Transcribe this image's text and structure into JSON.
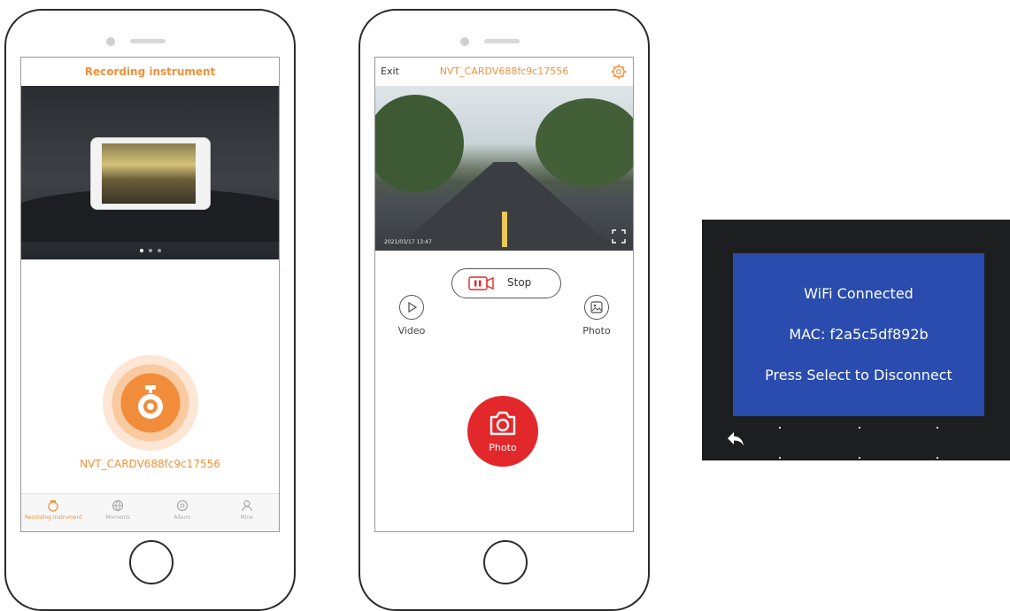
{
  "phone1": {
    "title": "Recording instrument",
    "device_name": "NVT_CARDV688fc9c17556",
    "nav": [
      {
        "label": "Recording instrument",
        "icon": "dashcam-icon",
        "active": true
      },
      {
        "label": "Moments",
        "icon": "globe-icon",
        "active": false
      },
      {
        "label": "Album",
        "icon": "album-icon",
        "active": false
      },
      {
        "label": "Mine",
        "icon": "person-icon",
        "active": false
      }
    ]
  },
  "phone2": {
    "exit_label": "Exit",
    "title": "NVT_CARDV688fc9c17556",
    "timestamp": "2021/03/17 13:47",
    "stop_label": "Stop",
    "video_label": "Video",
    "photo_label": "Photo",
    "shutter_label": "Photo"
  },
  "camera_screen": {
    "line1": "WiFi Connected",
    "line2": "MAC: f2a5c5df892b",
    "line3": "Press Select to Disconnect"
  },
  "colors": {
    "accent_orange": "#f0913b",
    "shutter_red": "#e2282b",
    "lcd_blue": "#2a4cae"
  }
}
